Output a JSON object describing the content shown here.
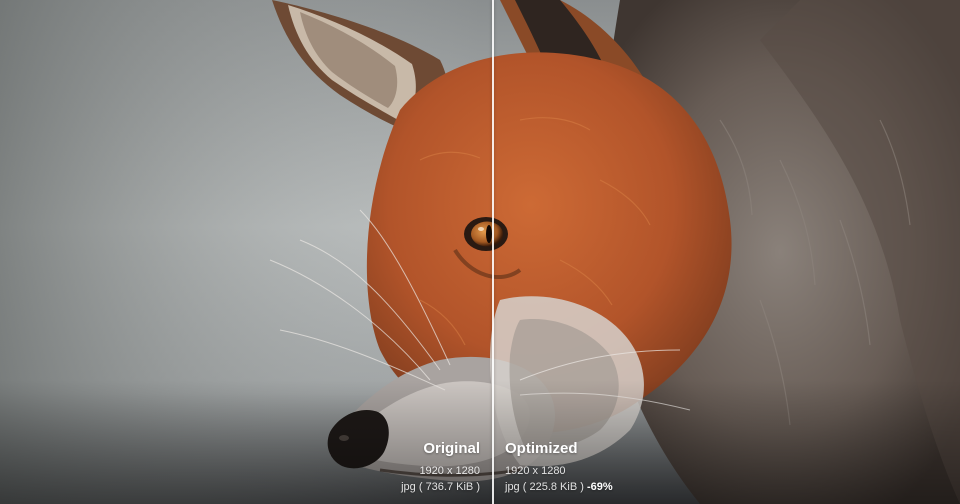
{
  "comparison": {
    "left": {
      "title": "Original",
      "dimensions": "1920 x 1280",
      "format": "jpg",
      "size": "736.7 KiB"
    },
    "right": {
      "title": "Optimized",
      "dimensions": "1920 x 1280",
      "format": "jpg",
      "size": "225.8 KiB",
      "savings": "-69%"
    }
  },
  "image": {
    "subject": "red-fox-closeup"
  },
  "colors": {
    "label": "#ffffff",
    "divider": "#ffffff",
    "fox_orange": "#b5562a",
    "fur_grey": "#6f6862",
    "eye": "#b06424"
  }
}
